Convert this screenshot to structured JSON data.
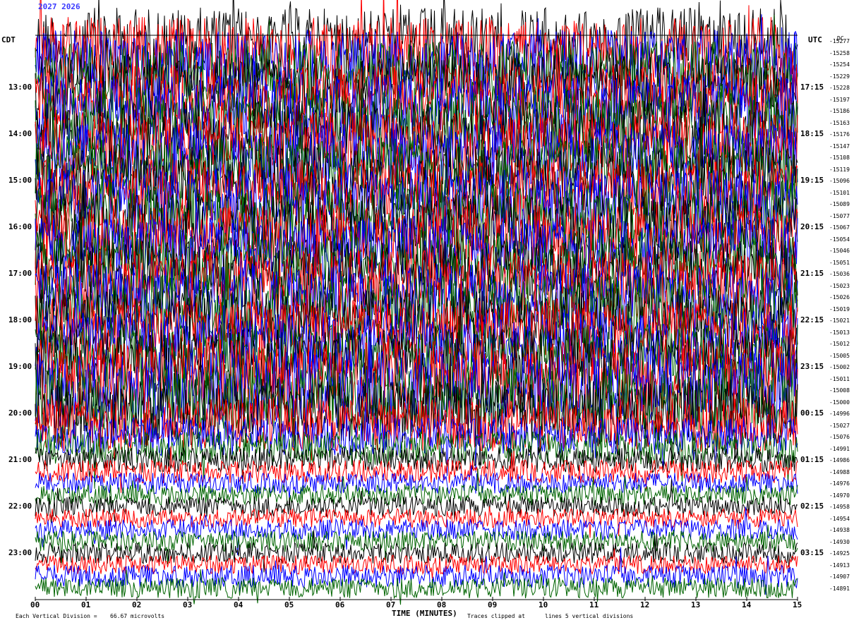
{
  "header": {
    "date_text": "2027 2026",
    "left_zone": "CDT",
    "right_zone": "UTC",
    "dc_label": "DC"
  },
  "chart_data": {
    "type": "line",
    "title": "",
    "xlabel": "TIME (MINUTES)",
    "ylabel": "",
    "x_ticks": [
      "00",
      "01",
      "02",
      "03",
      "04",
      "05",
      "06",
      "07",
      "08",
      "09",
      "10",
      "11",
      "12",
      "13",
      "14",
      "15"
    ],
    "xlim": [
      0,
      15
    ],
    "left_times": [
      "13:00",
      "14:00",
      "15:00",
      "16:00",
      "17:00",
      "18:00",
      "19:00",
      "20:00",
      "21:00",
      "22:00",
      "23:00"
    ],
    "right_times": [
      "17:15",
      "18:15",
      "19:15",
      "20:15",
      "21:15",
      "22:15",
      "23:15",
      "00:15",
      "01:15",
      "02:15",
      "03:15"
    ],
    "dc_offsets": [
      "-15277",
      "-15258",
      "-15254",
      "-15229",
      "-15228",
      "-15197",
      "-15186",
      "-15163",
      "-15176",
      "-15147",
      "-15108",
      "-15119",
      "-15096",
      "-15101",
      "-15089",
      "-15077",
      "-15067",
      "-15054",
      "-15046",
      "-15051",
      "-15036",
      "-15023",
      "-15026",
      "-15019",
      "-15021",
      "-15013",
      "-15012",
      "-15005",
      "-15002",
      "-15011",
      "-15008",
      "-15000",
      "-14996",
      "-15027",
      "-15076",
      "-14991",
      "-14986",
      "-14988",
      "-14976",
      "-14970",
      "-14958",
      "-14954",
      "-14938",
      "-14930",
      "-14925",
      "-14913",
      "-14907",
      "-14891"
    ],
    "trace_colors": [
      "#000000",
      "#ff0000",
      "#0000ff",
      "#006400"
    ],
    "traces_per_hour": 4,
    "amplitude_profile": [
      3.2,
      3.4,
      3.3,
      3.3,
      3.2,
      3.3,
      3.4,
      3.3,
      3.2,
      3.3,
      3.4,
      3.3,
      3.3,
      3.2,
      3.3,
      3.4,
      3.2,
      3.3,
      3.3,
      3.2,
      3.2,
      3.3,
      3.2,
      3.2,
      3.1,
      3.2,
      3.1,
      3.0,
      3.6,
      3.8,
      3.7,
      3.5,
      3.3,
      2.6,
      1.8,
      1.6,
      1.2,
      1.1,
      1.0,
      1.0,
      1.0,
      0.9,
      1.0,
      1.0,
      1.0,
      0.9,
      1.1,
      1.0
    ],
    "series_note": "48 helicorder traces, 15 minutes each"
  },
  "footer": {
    "scale_text": "Each Vertical Division =",
    "scale_value": "66.67 microvolts",
    "clip_text": "Traces clipped at",
    "clip_tail": "lines 5 vertical divisions"
  }
}
